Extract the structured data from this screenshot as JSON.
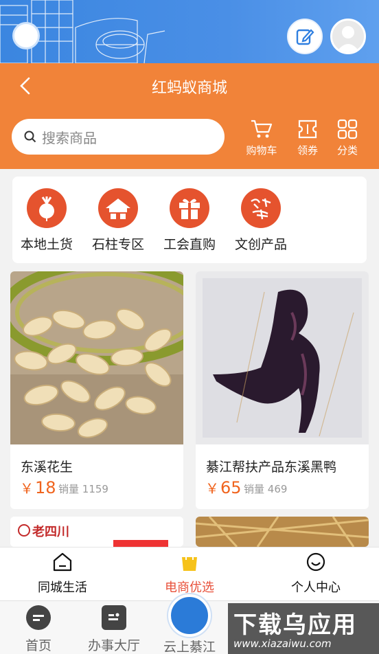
{
  "header": {
    "title": "红蚂蚁商城"
  },
  "search": {
    "placeholder": "搜索商品"
  },
  "tools": [
    {
      "label": "购物车",
      "icon": "cart-icon"
    },
    {
      "label": "领券",
      "icon": "coupon-icon"
    },
    {
      "label": "分类",
      "icon": "grid-icon"
    }
  ],
  "categories": [
    {
      "label": "本地土货",
      "icon": "radish-icon"
    },
    {
      "label": "石柱专区",
      "icon": "house-icon"
    },
    {
      "label": "工会直购",
      "icon": "gift-icon"
    },
    {
      "label": "文创产品",
      "icon": "calligraphy-icon"
    }
  ],
  "products": [
    {
      "name": "东溪花生",
      "currency": "￥",
      "price": "18",
      "sales_label": "销量",
      "sales": "1159"
    },
    {
      "name": "綦江帮扶产品东溪黑鸭",
      "currency": "￥",
      "price": "65",
      "sales_label": "销量",
      "sales": "469"
    }
  ],
  "partial_cards": [
    {
      "brand": "老四川"
    },
    {
      "brand": ""
    }
  ],
  "tabbar": [
    {
      "label": "同城生活",
      "icon": "home-icon",
      "active": false
    },
    {
      "label": "电商优选",
      "icon": "shopping-bag-icon",
      "active": true
    },
    {
      "label": "个人中心",
      "icon": "smile-icon",
      "active": false
    }
  ],
  "bottom_nav": [
    {
      "label": "首页",
      "icon": "chat-bubble-icon"
    },
    {
      "label": "办事大厅",
      "icon": "id-card-icon"
    },
    {
      "label": "云上綦江",
      "icon": "app-logo-icon"
    }
  ],
  "watermark": {
    "line1": "下载乌应用",
    "line2": "www.xiazaiwu.com"
  },
  "colors": {
    "accent": "#f18339",
    "price": "#f0641e",
    "banner": "#3b86e0",
    "active_tab": "#e8503a"
  }
}
